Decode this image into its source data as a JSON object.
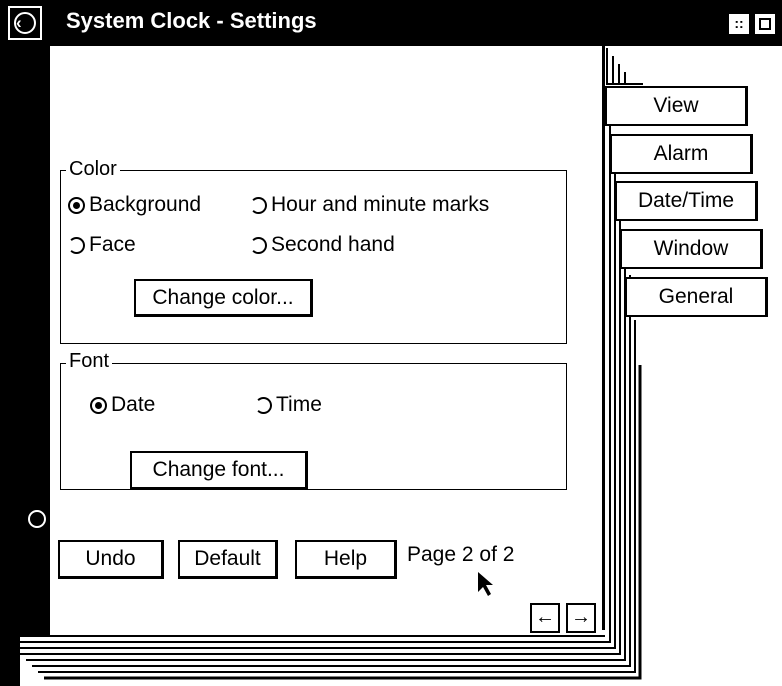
{
  "window": {
    "title": "System Clock - Settings"
  },
  "tabs": [
    {
      "label": "View"
    },
    {
      "label": "Alarm"
    },
    {
      "label": "Date/Time"
    },
    {
      "label": "Window"
    },
    {
      "label": "General"
    }
  ],
  "color_group": {
    "legend": "Color",
    "options": [
      {
        "label": "Background",
        "selected": true
      },
      {
        "label": "Hour and minute marks",
        "selected": false
      },
      {
        "label": "Face",
        "selected": false
      },
      {
        "label": "Second hand",
        "selected": false
      }
    ],
    "button": "Change color..."
  },
  "font_group": {
    "legend": "Font",
    "options": [
      {
        "label": "Date",
        "selected": true
      },
      {
        "label": "Time",
        "selected": false
      }
    ],
    "button": "Change font..."
  },
  "footer": {
    "undo": "Undo",
    "default": "Default",
    "help": "Help",
    "page_info": "Page 2 of 2"
  },
  "icons": {
    "system_menu": "system-menu-icon",
    "minimize": "minimize-icon",
    "maximize": "maximize-icon",
    "prev_page": "arrow-left-icon",
    "next_page": "arrow-right-icon",
    "cursor": "mouse-pointer-icon"
  }
}
